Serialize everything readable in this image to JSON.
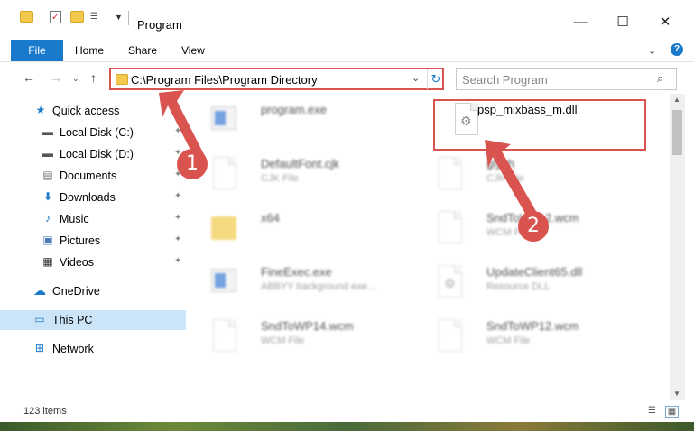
{
  "window": {
    "title": "Program",
    "minimize": "—",
    "maximize": "☐",
    "close": "✕"
  },
  "ribbon": {
    "tabs": [
      "File",
      "Home",
      "Share",
      "View"
    ]
  },
  "address": {
    "path": "C:\\Program Files\\Program Directory"
  },
  "search": {
    "placeholder": "Search Program"
  },
  "sidebar": {
    "items": [
      {
        "label": "Quick access"
      },
      {
        "label": "Local Disk (C:)"
      },
      {
        "label": "Local Disk (D:)"
      },
      {
        "label": "Documents"
      },
      {
        "label": "Downloads"
      },
      {
        "label": "Music"
      },
      {
        "label": "Pictures"
      },
      {
        "label": "Videos"
      },
      {
        "label": "OneDrive"
      },
      {
        "label": "This PC"
      },
      {
        "label": "Network"
      }
    ]
  },
  "files": [
    {
      "name": "program.exe",
      "type": ""
    },
    {
      "name": "psp_mixbass_m.dll",
      "type": ""
    },
    {
      "name": "DefaultFont.cjk",
      "type": "CJK File"
    },
    {
      "name": "glyph",
      "type": "CJK File"
    },
    {
      "name": "x64",
      "type": ""
    },
    {
      "name": "SndToWP12.wcm",
      "type": "WCM File"
    },
    {
      "name": "FineExec.exe",
      "type": "ABBYY background exe..."
    },
    {
      "name": "UpdateClient65.dll",
      "type": "Resource DLL"
    },
    {
      "name": "SndToWP14.wcm",
      "type": "WCM File"
    },
    {
      "name": "SndToWP12.wcm",
      "type": "WCM File"
    }
  ],
  "status": {
    "count": "123 items"
  },
  "annotations": {
    "step1": "1",
    "step2": "2"
  },
  "colors": {
    "accent": "#1979ca",
    "highlight": "#d9534f",
    "selected": "#cce4f7"
  }
}
